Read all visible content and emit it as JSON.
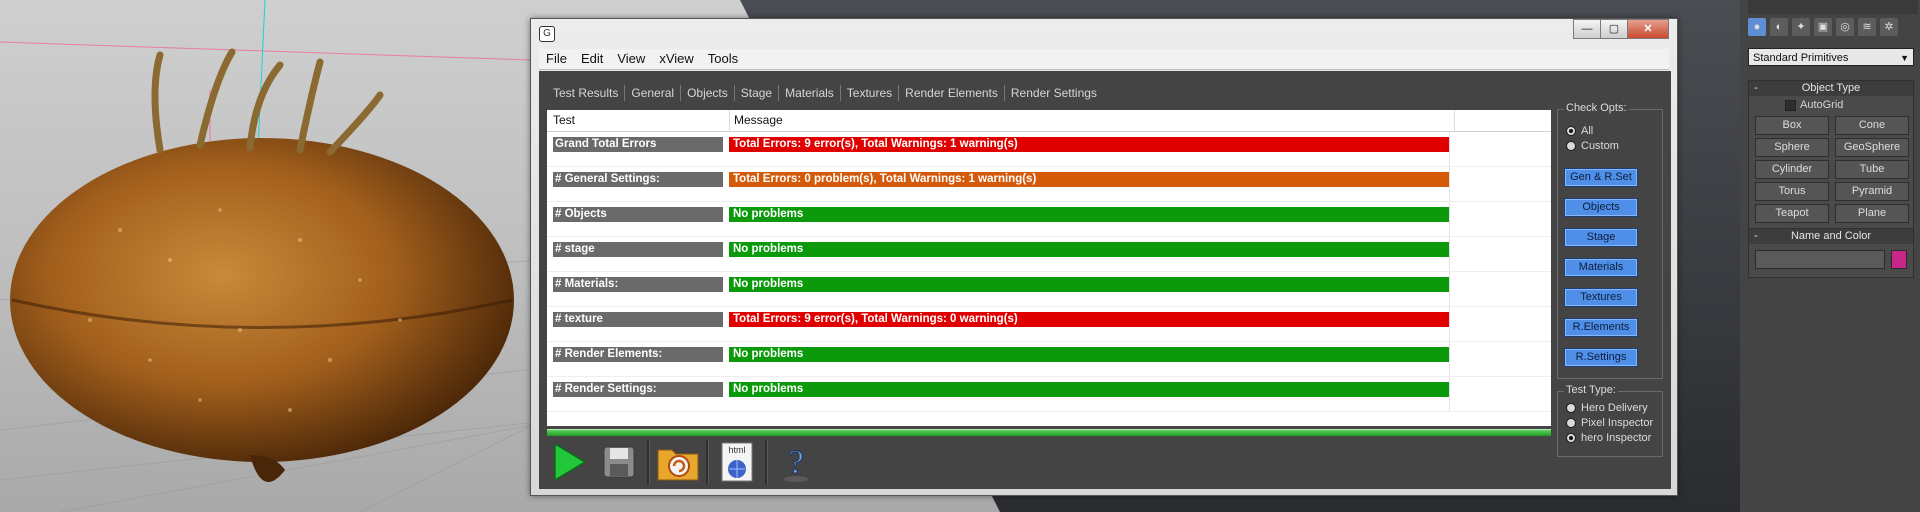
{
  "window": {
    "icon_glyph": "G",
    "buttons": {
      "minimize": "—",
      "maximize": "▢",
      "close": "✕"
    }
  },
  "menu": [
    "File",
    "Edit",
    "View",
    "xView",
    "Tools"
  ],
  "tabs": [
    "Test Results",
    "General",
    "Objects",
    "Stage",
    "Materials",
    "Textures",
    "Render Elements",
    "Render Settings"
  ],
  "table": {
    "headers": [
      "Test",
      "Message"
    ],
    "rows": [
      {
        "test": "Grand Total Errors",
        "message": "Total Errors: 9 error(s), Total Warnings: 1 warning(s)",
        "color": "#e00000"
      },
      {
        "test": "# General Settings:",
        "message": "Total Errors: 0 problem(s), Total Warnings: 1 warning(s)",
        "color": "#d45a0a"
      },
      {
        "test": "# Objects",
        "message": "No problems",
        "color": "#0c9a0c"
      },
      {
        "test": "# stage",
        "message": "No problems",
        "color": "#0c9a0c"
      },
      {
        "test": "# Materials:",
        "message": "No problems",
        "color": "#0c9a0c"
      },
      {
        "test": "# texture",
        "message": "Total Errors: 9 error(s), Total Warnings: 0 warning(s)",
        "color": "#e00000"
      },
      {
        "test": "# Render Elements:",
        "message": "No problems",
        "color": "#0c9a0c"
      },
      {
        "test": "# Render Settings:",
        "message": "No problems",
        "color": "#0c9a0c"
      }
    ]
  },
  "check_opts": {
    "label": "Check Opts:",
    "radios": [
      {
        "label": "All",
        "selected": true
      },
      {
        "label": "Custom",
        "selected": false
      }
    ],
    "buttons": [
      "Gen & R.Set",
      "Objects",
      "Stage",
      "Materials",
      "Textures",
      "R.Elements",
      "R.Settings"
    ]
  },
  "test_type": {
    "label": "Test Type:",
    "radios": [
      {
        "label": "Hero Delivery",
        "selected": false
      },
      {
        "label": "Pixel Inspector",
        "selected": false
      },
      {
        "label": "hero Inspector",
        "selected": true
      }
    ]
  },
  "toolbar": {
    "icons": [
      "play-icon",
      "save-icon",
      "open-folder-icon",
      "html-export-icon",
      "help-icon"
    ],
    "html_badge": "html"
  },
  "command_panel": {
    "dropdown_value": "Standard Primitives",
    "object_type_title": "Object Type",
    "autogrid_label": "AutoGrid",
    "primitives": [
      "Box",
      "Cone",
      "Sphere",
      "GeoSphere",
      "Cylinder",
      "Tube",
      "Torus",
      "Pyramid",
      "Teapot",
      "Plane"
    ],
    "name_color_title": "Name and Color",
    "object_color": "#c8278a",
    "collapse_glyph": "-"
  }
}
